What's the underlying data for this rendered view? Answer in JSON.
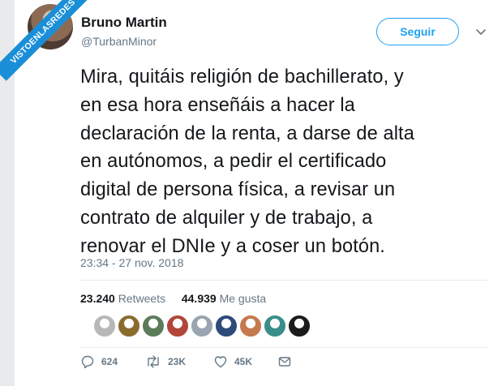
{
  "watermark": {
    "text": "VISTOENLASREDES"
  },
  "author": {
    "name": "Bruno Martin",
    "handle": "@TurbanMinor"
  },
  "follow_button": {
    "label": "Seguir"
  },
  "tweet": {
    "lines": [
      "Mira, quitáis religión de bachillerato, y",
      "en esa hora enseñáis a hacer la",
      "declaración de la renta, a darse de alta",
      "en autónomos, a pedir el certificado",
      "digital de persona física, a revisar un",
      "contrato de alquiler y de trabajo, a",
      "renovar el DNIe y a coser un botón."
    ],
    "timestamp": "23:34 - 27 nov. 2018"
  },
  "stats": {
    "retweets_count": "23.240",
    "retweets_label": "Retweets",
    "likes_count": "44.939",
    "likes_label": "Me gusta"
  },
  "likers": [
    {
      "name": "liker-1-avatar",
      "color": "#b8b8b8"
    },
    {
      "name": "liker-2-avatar",
      "color": "#8b6a2e"
    },
    {
      "name": "liker-3-avatar",
      "color": "#5b7b5a"
    },
    {
      "name": "liker-4-avatar",
      "color": "#b0463a"
    },
    {
      "name": "liker-5-avatar",
      "color": "#9aa5b1"
    },
    {
      "name": "liker-6-avatar",
      "color": "#2e4a7a"
    },
    {
      "name": "liker-7-avatar",
      "color": "#c47a4e"
    },
    {
      "name": "liker-8-avatar",
      "color": "#3a8e8a"
    },
    {
      "name": "liker-9-avatar",
      "color": "#1c1c1c"
    }
  ],
  "actions": {
    "replies": "624",
    "retweets": "23K",
    "likes": "45K"
  },
  "colors": {
    "accent": "#1da1f2",
    "text": "#14171a",
    "muted": "#657786",
    "watermark": "#1a8fd8"
  }
}
